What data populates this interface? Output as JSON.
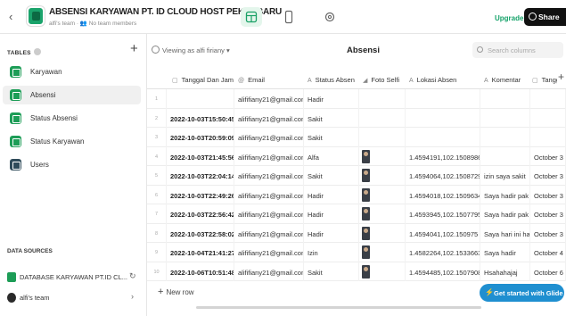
{
  "header": {
    "title": "ABSENSI KARYAWAN PT. ID CLOUD HOST PEKANBARU",
    "subtitle": "alfi's team · 👥 No team members",
    "upgrade_label": "Upgrade",
    "share_label": "Share"
  },
  "sidebar": {
    "tables_heading": "TABLES",
    "items": [
      {
        "label": "Karyawan"
      },
      {
        "label": "Absensi"
      },
      {
        "label": "Status Absensi"
      },
      {
        "label": "Status Karyawan"
      },
      {
        "label": "Users"
      }
    ],
    "data_sources_heading": "DATA SOURCES",
    "data_source": "DATABASE KARYAWAN PT.ID CL...",
    "team": "alfi's team"
  },
  "main": {
    "viewing": "Viewing as alfi firiany",
    "table_title": "Absensi",
    "search_placeholder": "Search columns",
    "columns": [
      "Tanggal Dan Jam",
      "Email",
      "Status Absen",
      "Foto Selfi",
      "Lokasi Absen",
      "Komentar",
      "Tangg"
    ],
    "rows": [
      {
        "n": "1",
        "dt": "",
        "email": "alififiany21@gmail.com",
        "status": "Hadir",
        "photo": false,
        "loc": "",
        "kom": "",
        "tg": ""
      },
      {
        "n": "2",
        "dt": "2022-10-03T15:50:45",
        "email": "alififiany21@gmail.com",
        "status": "Sakit",
        "photo": false,
        "loc": "",
        "kom": "",
        "tg": ""
      },
      {
        "n": "3",
        "dt": "2022-10-03T20:59:09",
        "email": "alififiany21@gmail.com",
        "status": "Sakit",
        "photo": false,
        "loc": "",
        "kom": "",
        "tg": ""
      },
      {
        "n": "4",
        "dt": "2022-10-03T21:45:56",
        "email": "alififiany21@gmail.com",
        "status": "Alfa",
        "photo": true,
        "loc": "1.4594191,102.1508986",
        "kom": "",
        "tg": "October 3"
      },
      {
        "n": "5",
        "dt": "2022-10-03T22:04:14",
        "email": "alififiany21@gmail.com",
        "status": "Sakit",
        "photo": true,
        "loc": "1.4594064,102.1508729",
        "kom": "izin saya sakit",
        "tg": "October 3"
      },
      {
        "n": "6",
        "dt": "2022-10-03T22:49:26",
        "email": "alififiany21@gmail.com",
        "status": "Hadir",
        "photo": true,
        "loc": "1.4594018,102.1509634",
        "kom": "Saya hadir pak",
        "tg": "October 3"
      },
      {
        "n": "7",
        "dt": "2022-10-03T22:56:42",
        "email": "alififiany21@gmail.com",
        "status": "Hadir",
        "photo": true,
        "loc": "1.4593945,102.1507795",
        "kom": "Saya hadir pak l",
        "tg": "October 3"
      },
      {
        "n": "8",
        "dt": "2022-10-03T22:58:02",
        "email": "alififiany21@gmail.com",
        "status": "Hadir",
        "photo": true,
        "loc": "1.4594041,102.150975",
        "kom": "Saya hari ini hac",
        "tg": "October 3"
      },
      {
        "n": "9",
        "dt": "2022-10-04T21:41:27.",
        "email": "alififiany21@gmail.com",
        "status": "Izin",
        "photo": true,
        "loc": "1.4582264,102.1533663",
        "kom": "Saya hadir",
        "tg": "October 4"
      },
      {
        "n": "10",
        "dt": "2022-10-06T10:51:48.",
        "email": "alififiany21@gmail.com",
        "status": "Sakit",
        "photo": true,
        "loc": "1.4594485,102.1507908",
        "kom": "Hsahahajaj",
        "tg": "October 6"
      }
    ],
    "new_row_label": "New row"
  },
  "get_started_label": "Get started with Glide"
}
